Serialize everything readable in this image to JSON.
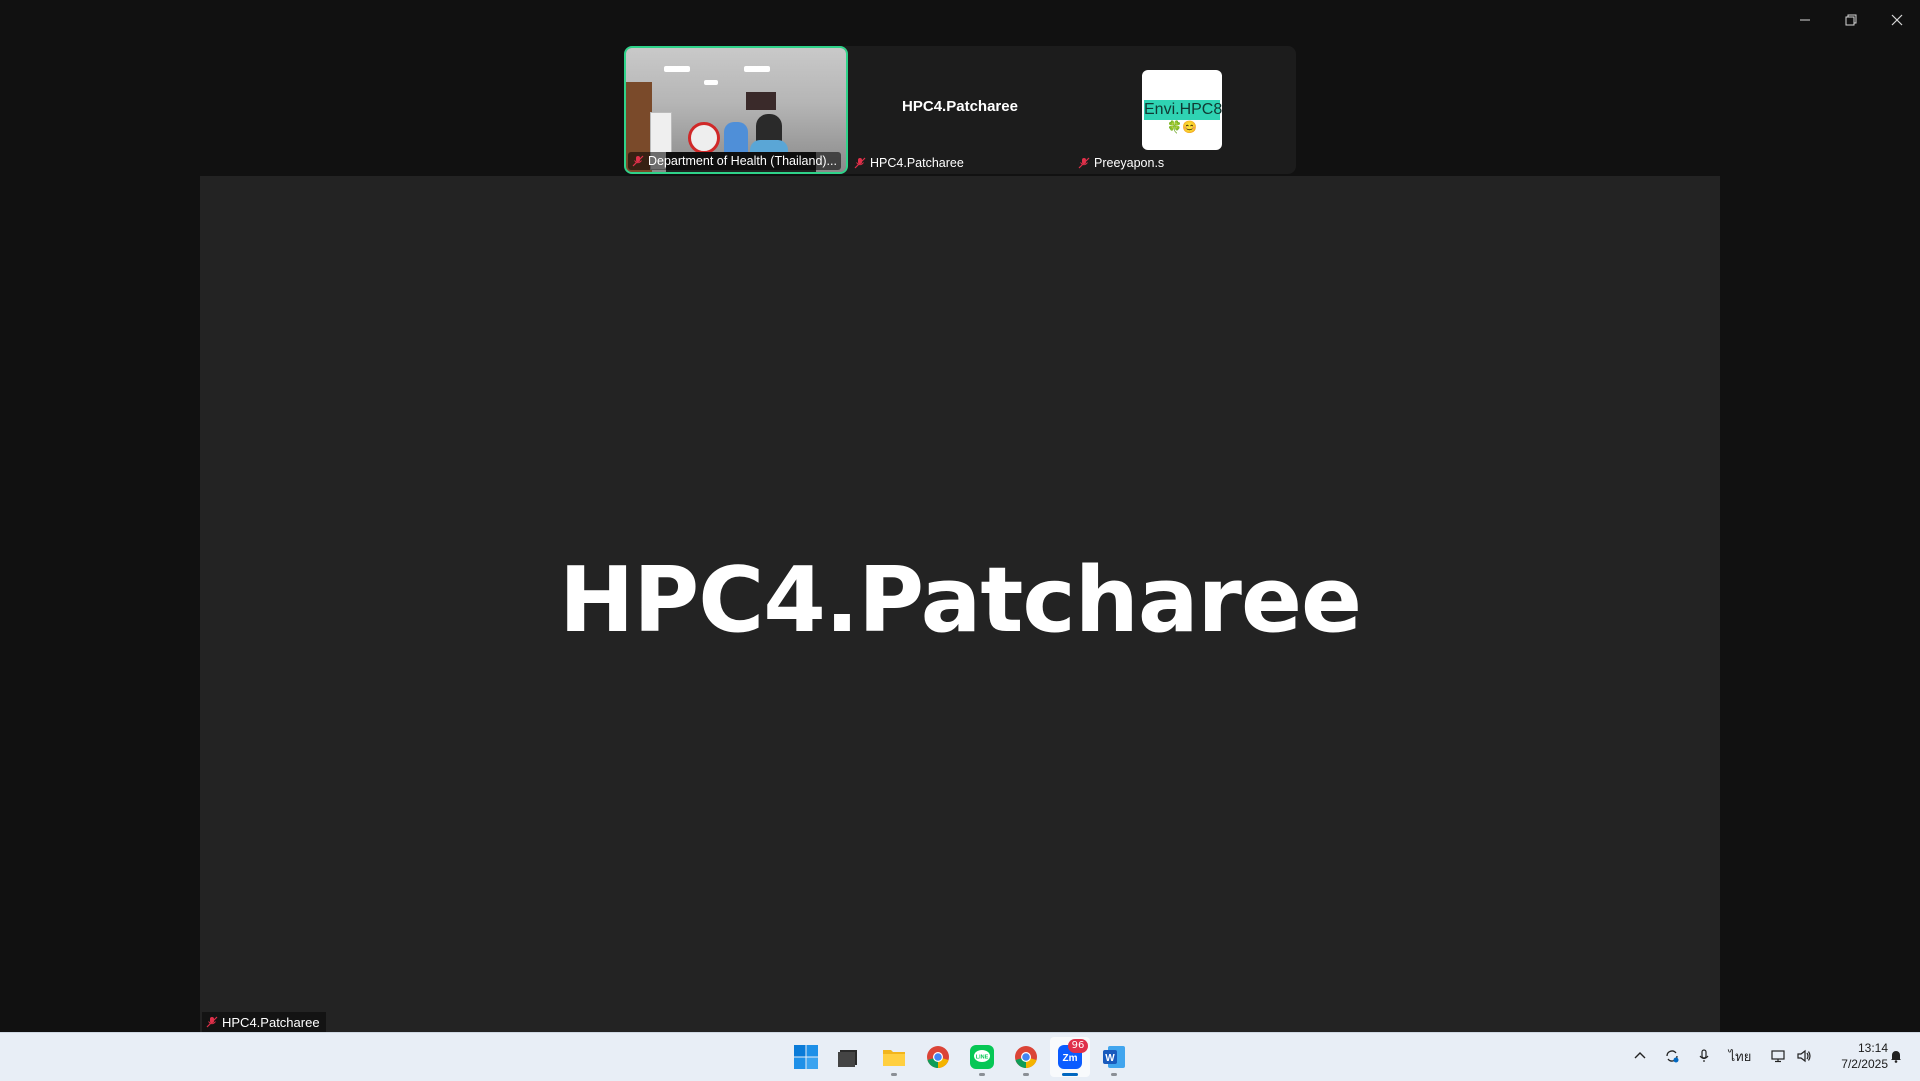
{
  "window": {
    "controls": [
      "minimize-icon",
      "restore-icon",
      "close-icon"
    ]
  },
  "participants": [
    {
      "name": "Department of Health (Thailand)...",
      "video": true,
      "muted": true,
      "active_speaker_border": "#2fd38a"
    },
    {
      "name": "HPC4.Patcharee",
      "display_name": "HPC4.Patcharee",
      "video": false,
      "muted": true
    },
    {
      "name": "Preeyapon.s",
      "avatar_text": "Envi.HPC8",
      "avatar_emoji": "🍀😊",
      "video": false,
      "muted": true
    }
  ],
  "stage": {
    "speaker_name": "HPC4.Patcharee",
    "label": "HPC4.Patcharee"
  },
  "taskbar": {
    "apps": [
      {
        "name": "start-button",
        "icon": "windows-icon"
      },
      {
        "name": "task-view",
        "icon": "task-view-icon"
      },
      {
        "name": "file-explorer",
        "icon": "folder-icon",
        "running": true
      },
      {
        "name": "chrome",
        "icon": "chrome-icon"
      },
      {
        "name": "line",
        "icon": "line-icon",
        "running": true
      },
      {
        "name": "chrome-profile",
        "icon": "chrome-icon",
        "running": true
      },
      {
        "name": "zoom",
        "icon": "zoom-icon",
        "badge": "96",
        "running": true,
        "active": true
      },
      {
        "name": "word",
        "icon": "word-icon",
        "running": true
      }
    ],
    "tray": {
      "language": "ไทย",
      "time": "13:14",
      "date": "7/2/2025"
    }
  },
  "colors": {
    "background": "#111111",
    "stage": "#232323",
    "strip": "#1c1c1c",
    "active_border": "#2fd38a",
    "mute": "#e0304a",
    "taskbar": "#e8eef6"
  }
}
